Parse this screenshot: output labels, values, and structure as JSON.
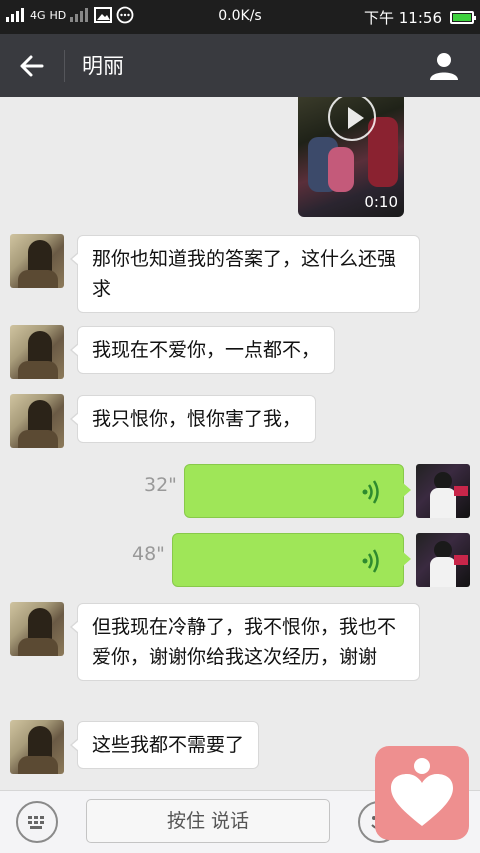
{
  "status_bar": {
    "network": "4G",
    "hd": "HD",
    "speed": "0.0K/s",
    "time": "下午 11:56"
  },
  "header": {
    "title": "明丽",
    "back_icon": "arrow-left-icon",
    "profile_icon": "person-icon"
  },
  "video": {
    "duration": "0:10"
  },
  "messages": [
    {
      "from": "other",
      "text": "那你也知道我的答案了，这什么还强求"
    },
    {
      "from": "other",
      "text": "我现在不爱你，一点都不，"
    },
    {
      "from": "other",
      "text": "我只恨你，恨你害了我，"
    },
    {
      "from": "me",
      "type": "voice",
      "duration": "32\""
    },
    {
      "from": "me",
      "type": "voice",
      "duration": "48\""
    },
    {
      "from": "other",
      "text": "但我现在冷静了，我不恨你，我也不爱你，谢谢你给我这次经历，谢谢"
    },
    {
      "from": "other",
      "text": "这些我都不需要了"
    }
  ],
  "input_bar": {
    "hold_to_talk": "按住 说话"
  },
  "colors": {
    "title_bar": "#393a3f",
    "voice_bubble": "#9fe658",
    "chat_background": "#ebebeb",
    "floating_app": "#ee8f8f"
  }
}
